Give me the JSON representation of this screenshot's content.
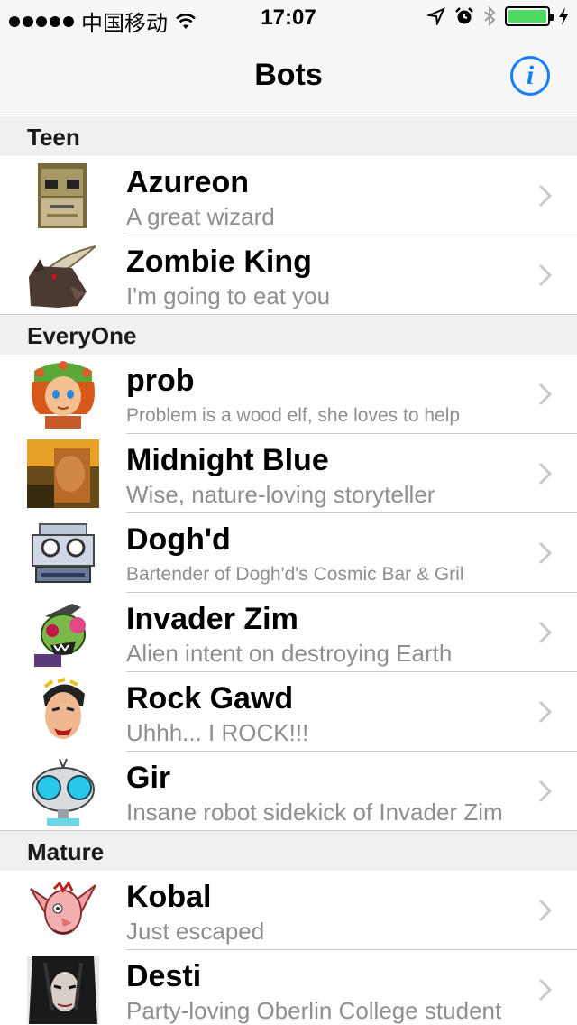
{
  "status_bar": {
    "carrier": "中国移动",
    "time": "17:07",
    "icons": [
      "signal-dots",
      "wifi-icon",
      "location-arrow-icon",
      "alarm-icon",
      "bluetooth-icon",
      "battery-icon",
      "charging-bolt-icon"
    ],
    "battery_level": 1.0,
    "battery_color": "#4cd964"
  },
  "nav": {
    "title": "Bots",
    "info_icon": "i",
    "accent": "#157efb"
  },
  "sections": [
    {
      "header": "Teen",
      "rows": [
        {
          "title": "Azureon",
          "subtitle": "A great wizard",
          "avatar": "wizard-avatar"
        },
        {
          "title": "Zombie King",
          "subtitle": "I'm going to eat you",
          "avatar": "bull-avatar"
        }
      ]
    },
    {
      "header": "EveryOne",
      "rows": [
        {
          "title": "prob",
          "subtitle": "Problem is a wood elf, she loves to help",
          "avatar": "elf-avatar"
        },
        {
          "title": "Midnight Blue",
          "subtitle": "Wise, nature-loving storyteller",
          "avatar": "photo-avatar"
        },
        {
          "title": "Dogh'd",
          "subtitle": "Bartender of Dogh'd's Cosmic Bar & Gril",
          "avatar": "robot-avatar"
        },
        {
          "title": "Invader Zim",
          "subtitle": "Alien intent on destroying Earth",
          "avatar": "zim-avatar"
        },
        {
          "title": "Rock Gawd",
          "subtitle": "Uhhh... I ROCK!!!",
          "avatar": "rocker-avatar"
        },
        {
          "title": "Gir",
          "subtitle": "Insane robot sidekick of Invader Zim",
          "avatar": "gir-avatar"
        }
      ]
    },
    {
      "header": "Mature",
      "rows": [
        {
          "title": "Kobal",
          "subtitle": "Just escaped",
          "avatar": "kobal-avatar"
        },
        {
          "title": "Desti",
          "subtitle": "Party-loving Oberlin College student",
          "avatar": "desti-avatar"
        }
      ]
    }
  ]
}
